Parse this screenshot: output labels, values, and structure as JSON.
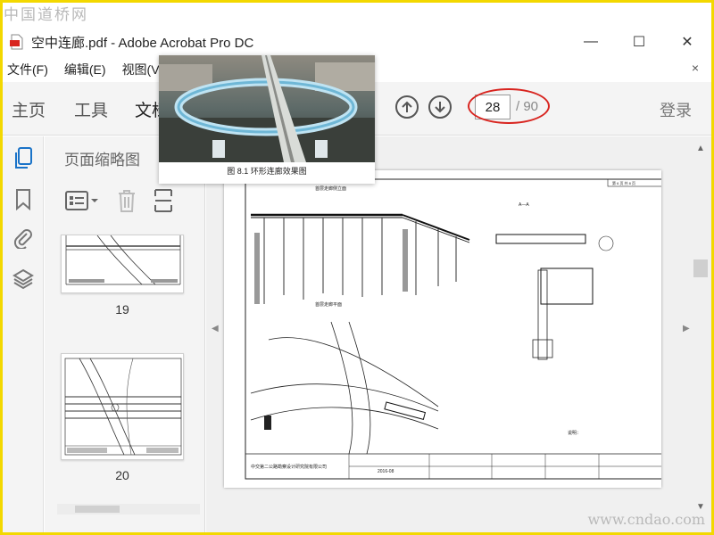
{
  "watermarks": {
    "top_left": "中国道桥网",
    "bottom_right": "www.cndao.com"
  },
  "window": {
    "title": "空中连廊.pdf - Adobe Acrobat Pro DC",
    "controls": {
      "minimize": "—",
      "maximize": "☐",
      "close": "✕"
    }
  },
  "menu": {
    "items": [
      "文件(F)",
      "编辑(E)",
      "视图(V"
    ],
    "close": "×"
  },
  "toolbar": {
    "tabs": [
      "主页",
      "工具",
      "文档"
    ],
    "current_page": "28",
    "total_pages": "/ 90",
    "login": "登录",
    "highlight_color": "#d8241f"
  },
  "panel": {
    "title": "页面缩略图",
    "thumbnails": [
      {
        "label": "19"
      },
      {
        "label": "20"
      }
    ]
  },
  "popup": {
    "caption": "图 8.1  环形连廊效果图"
  },
  "drawing": {
    "view_title_top": "首层走廊侧立面",
    "view_title_plan": "首层走廊平面",
    "section_label": "A—A",
    "company": "中交第二公路勘察设计研究院有限公司",
    "date": "2016-08",
    "notes_title": "说明：",
    "sheet_no": "第 6 页  共 8 页"
  },
  "icons": {
    "file": "pdf-file-icon",
    "rail": [
      "pages-icon",
      "bookmark-icon",
      "attachment-icon",
      "layers-icon"
    ],
    "tools": [
      "page-options-icon",
      "delete-icon",
      "extract-icon"
    ],
    "nav": [
      "arrow-up-icon",
      "arrow-down-icon"
    ]
  }
}
